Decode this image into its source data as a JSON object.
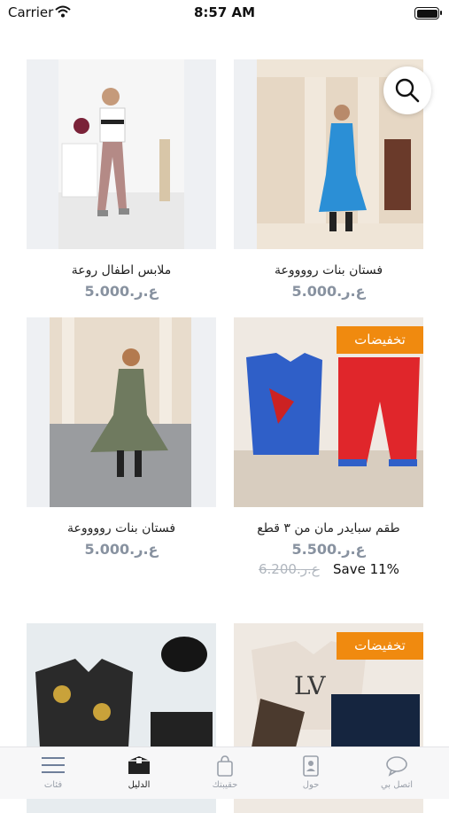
{
  "status_bar": {
    "carrier": "Carrier",
    "time": "8:57 AM"
  },
  "products": [
    {
      "title": "ملابس اطفال روعة",
      "price": "5.000.ع.ر",
      "badge": ""
    },
    {
      "title": "فستان بنات رووووعة",
      "price": "5.000.ع.ر",
      "badge": ""
    },
    {
      "title": "فستان بنات رووووعة",
      "price": "5.000.ع.ر",
      "badge": ""
    },
    {
      "title": "طقم سبايدر مان من ٣ قطع",
      "price": "5.500.ع.ر",
      "badge": "تخفيضات",
      "old_price": "6.200.ع.ر",
      "save": "Save 11%"
    },
    {
      "title": "",
      "price": "",
      "badge": ""
    },
    {
      "title": "",
      "price": "",
      "badge": "تخفيضات"
    }
  ],
  "tabs": [
    {
      "label": "فئات",
      "icon": "menu-icon",
      "active": false
    },
    {
      "label": "الدليل",
      "icon": "catalog-box-icon",
      "active": true
    },
    {
      "label": "حقيبتك",
      "icon": "shopping-bag-icon",
      "active": false
    },
    {
      "label": "حول",
      "icon": "contact-card-icon",
      "active": false
    },
    {
      "label": "اتصل بي",
      "icon": "chat-bubble-icon",
      "active": false
    }
  ],
  "colors": {
    "sale_badge": "#f08a0f",
    "price_gray": "#8892a0",
    "active_tab": "#222222"
  }
}
